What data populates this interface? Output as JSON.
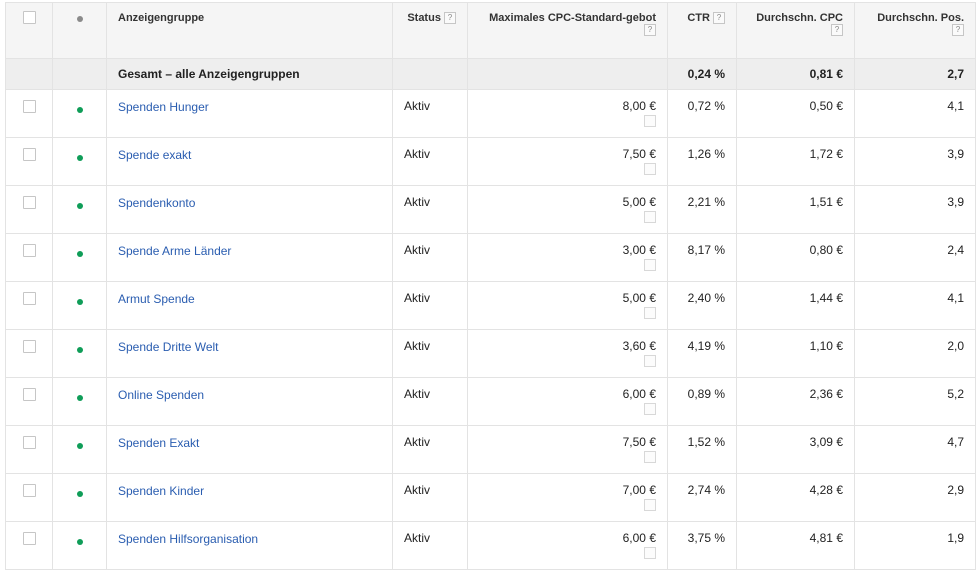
{
  "header": {
    "name": "Anzeigengruppe",
    "status": "Status",
    "bid": "Maximales CPC-Standard-gebot",
    "ctr": "CTR",
    "cpc": "Durchschn. CPC",
    "pos": "Durchschn. Pos.",
    "help": "?"
  },
  "total": {
    "label": "Gesamt – alle Anzeigengruppen",
    "ctr": "0,24 %",
    "cpc": "0,81 €",
    "pos": "2,7"
  },
  "rows": [
    {
      "name": "Spenden Hunger",
      "status": "Aktiv",
      "bid": "8,00 €",
      "ctr": "0,72 %",
      "cpc": "0,50 €",
      "pos": "4,1"
    },
    {
      "name": "Spende exakt",
      "status": "Aktiv",
      "bid": "7,50 €",
      "ctr": "1,26 %",
      "cpc": "1,72 €",
      "pos": "3,9"
    },
    {
      "name": "Spendenkonto",
      "status": "Aktiv",
      "bid": "5,00 €",
      "ctr": "2,21 %",
      "cpc": "1,51 €",
      "pos": "3,9"
    },
    {
      "name": "Spende Arme Länder",
      "status": "Aktiv",
      "bid": "3,00 €",
      "ctr": "8,17 %",
      "cpc": "0,80 €",
      "pos": "2,4"
    },
    {
      "name": "Armut Spende",
      "status": "Aktiv",
      "bid": "5,00 €",
      "ctr": "2,40 %",
      "cpc": "1,44 €",
      "pos": "4,1"
    },
    {
      "name": "Spende Dritte Welt",
      "status": "Aktiv",
      "bid": "3,60 €",
      "ctr": "4,19 %",
      "cpc": "1,10 €",
      "pos": "2,0"
    },
    {
      "name": "Online Spenden",
      "status": "Aktiv",
      "bid": "6,00 €",
      "ctr": "0,89 %",
      "cpc": "2,36 €",
      "pos": "5,2"
    },
    {
      "name": "Spenden Exakt",
      "status": "Aktiv",
      "bid": "7,50 €",
      "ctr": "1,52 %",
      "cpc": "3,09 €",
      "pos": "4,7"
    },
    {
      "name": "Spenden Kinder",
      "status": "Aktiv",
      "bid": "7,00 €",
      "ctr": "2,74 %",
      "cpc": "4,28 €",
      "pos": "2,9"
    },
    {
      "name": "Spenden Hilfsorganisation",
      "status": "Aktiv",
      "bid": "6,00 €",
      "ctr": "3,75 %",
      "cpc": "4,81 €",
      "pos": "1,9"
    }
  ],
  "colors": {
    "link": "#2a5db0",
    "status_dot": "#0f9d58",
    "header_bg": "#f5f5f5",
    "total_bg": "#eeeeee"
  }
}
